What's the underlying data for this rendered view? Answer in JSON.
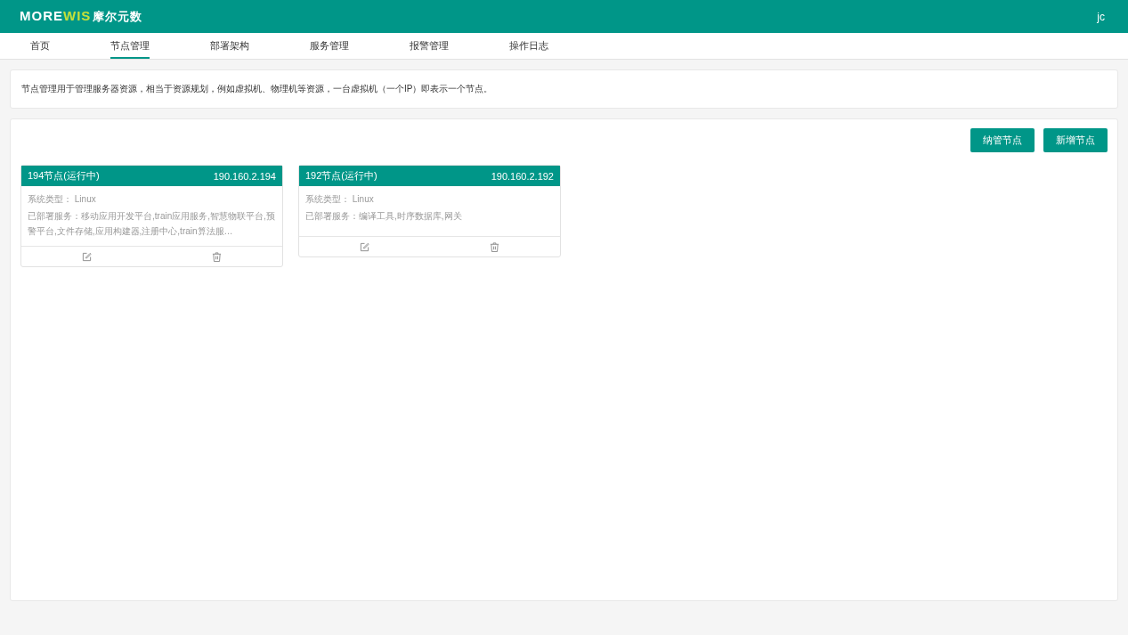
{
  "header": {
    "logo": {
      "primary": "MORE",
      "accent": "WIS",
      "chinese": "摩尔元数"
    },
    "user": "jc"
  },
  "tabs": [
    {
      "label": "首页",
      "selected": false
    },
    {
      "label": "节点管理",
      "selected": true
    },
    {
      "label": "部署架构",
      "selected": false
    },
    {
      "label": "服务管理",
      "selected": false
    },
    {
      "label": "报警管理",
      "selected": false
    },
    {
      "label": "操作日志",
      "selected": false
    }
  ],
  "description": "节点管理用于管理服务器资源，相当于资源规划，例如虚拟机、物理机等资源，一台虚拟机（一个IP）即表示一个节点。",
  "buttons": [
    "纳管节点",
    "新增节点"
  ],
  "nodes": [
    {
      "name": "194节点(运行中)",
      "ip": "190.160.2.194",
      "os_label": "系统类型：",
      "os": "Linux",
      "services_label": "已部署服务：",
      "services": "移动应用开发平台,train应用服务,智慧物联平台,预警平台,文件存储,应用构建器,注册中心,train算法服…"
    },
    {
      "name": "192节点(运行中)",
      "ip": "190.160.2.192",
      "os_label": "系统类型：",
      "os": "Linux",
      "services_label": "已部署服务：",
      "services": "编译工具,时序数据库,网关"
    }
  ]
}
